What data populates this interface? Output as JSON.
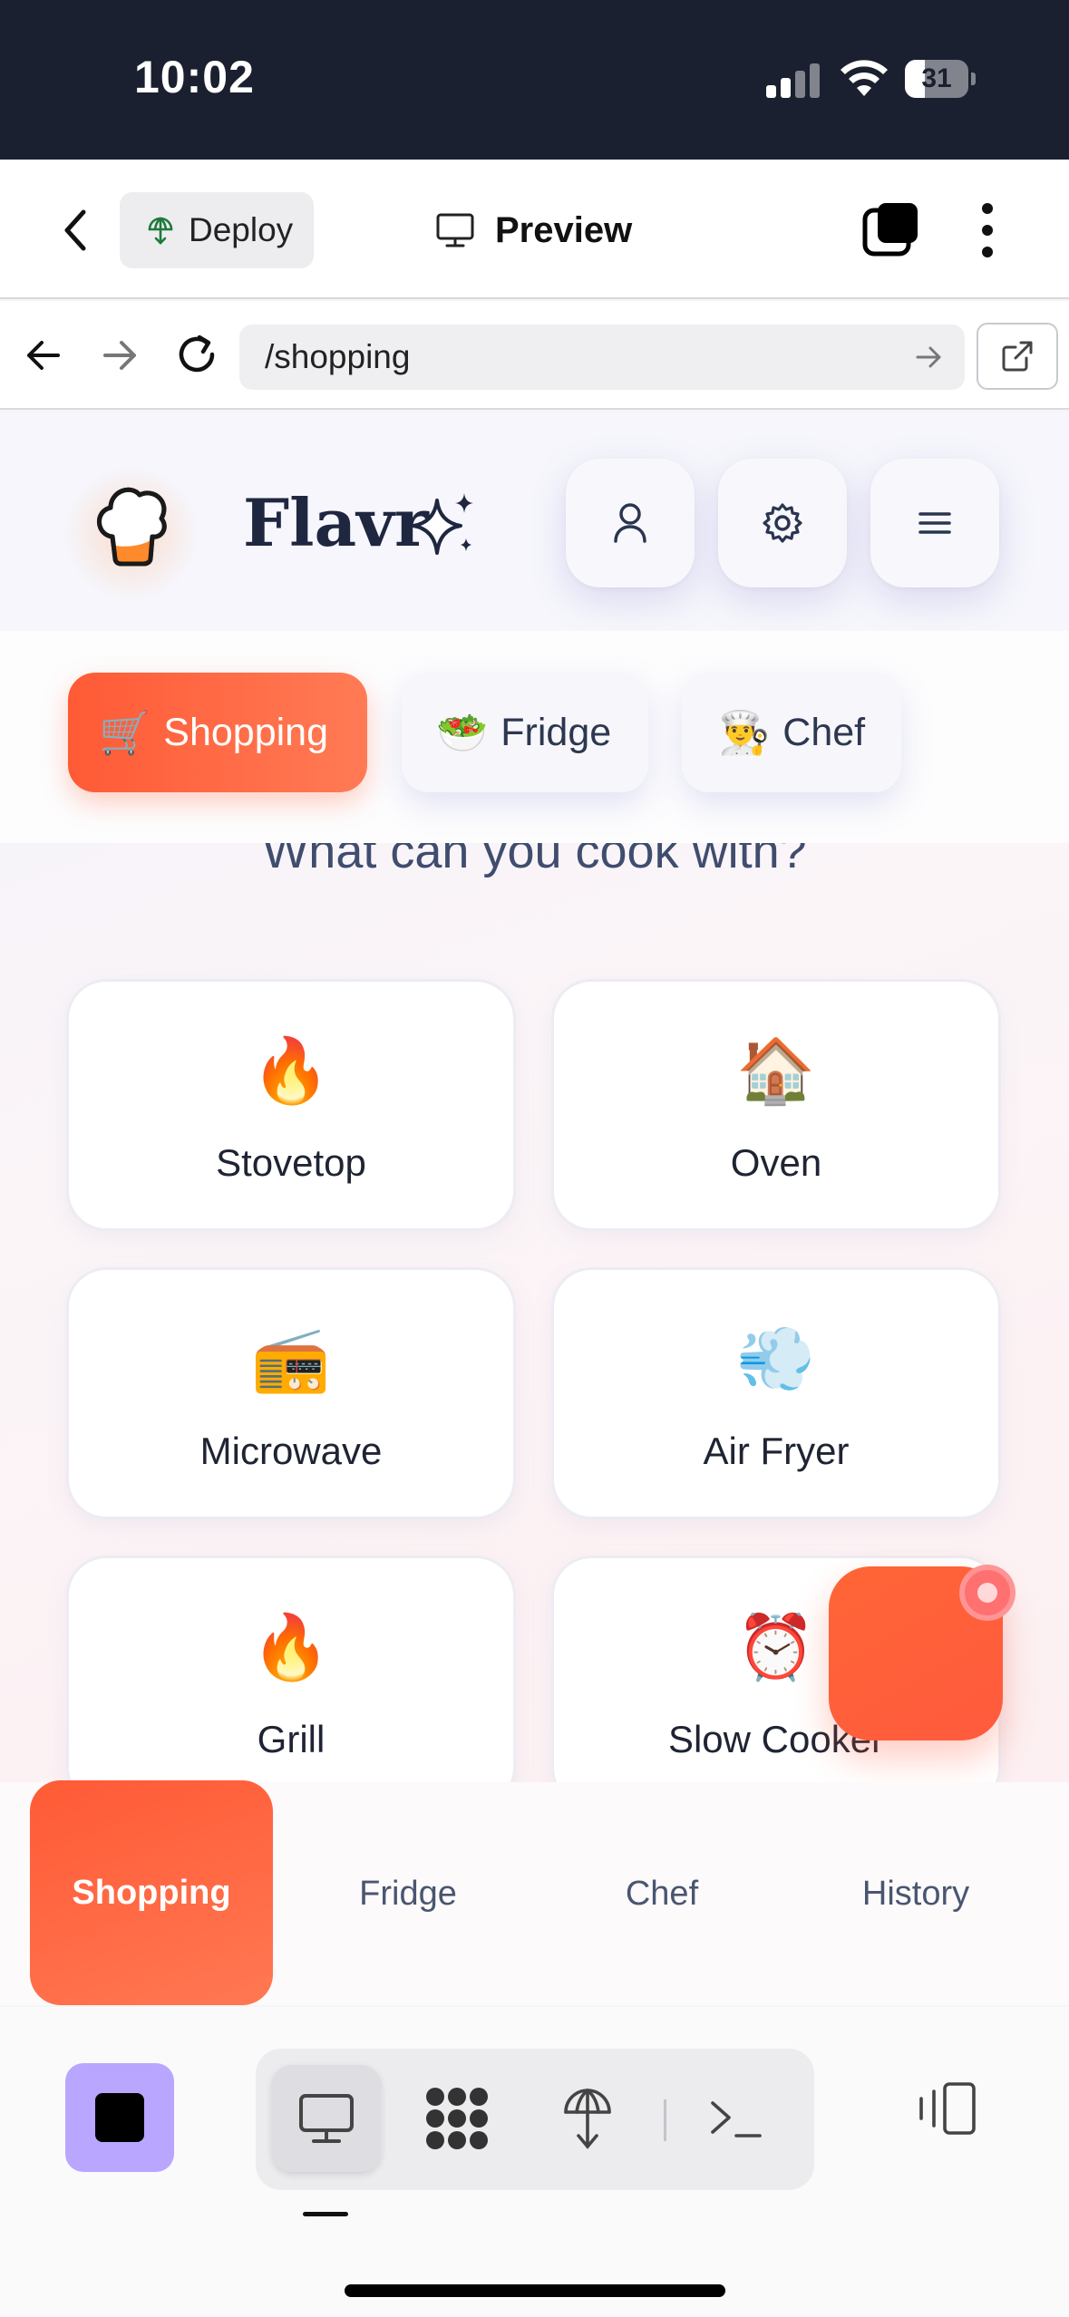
{
  "status_bar": {
    "time": "10:02",
    "battery": "31",
    "battery_level": 0.31
  },
  "toolbar": {
    "deploy_label": "Deploy",
    "preview_label": "Preview"
  },
  "url_bar": {
    "url": "/shopping"
  },
  "app": {
    "brand": "Flavr",
    "header_buttons": [
      "user-icon",
      "gear-icon",
      "menu-icon"
    ],
    "segments": [
      {
        "emoji": "🛒",
        "label": "Shopping",
        "active": true
      },
      {
        "emoji": "🥗",
        "label": "Fridge",
        "active": false
      },
      {
        "emoji": "👨‍🍳",
        "label": "Chef",
        "active": false
      }
    ],
    "question": "What can you cook with?",
    "appliances": [
      {
        "emoji": "🔥",
        "label": "Stovetop"
      },
      {
        "emoji": "🏠",
        "label": "Oven"
      },
      {
        "emoji": "📻",
        "label": "Microwave"
      },
      {
        "emoji": "💨",
        "label": "Air Fryer"
      },
      {
        "emoji": "🔥",
        "label": "Grill"
      },
      {
        "emoji": "⏰",
        "label": "Slow Cooker"
      }
    ],
    "bottom_nav": [
      {
        "label": "Shopping",
        "active": true
      },
      {
        "label": "Fridge",
        "active": false
      },
      {
        "label": "Chef",
        "active": false
      },
      {
        "label": "History",
        "active": false
      }
    ],
    "colors": {
      "accent": "#ff5a36",
      "brand_text": "#1f2740",
      "stop_button": "#b9a6ff"
    }
  },
  "ide_bar": {
    "modes": [
      "monitor-icon",
      "network-icon",
      "deploy-icon",
      "terminal-icon"
    ],
    "active_mode": "monitor-icon"
  }
}
